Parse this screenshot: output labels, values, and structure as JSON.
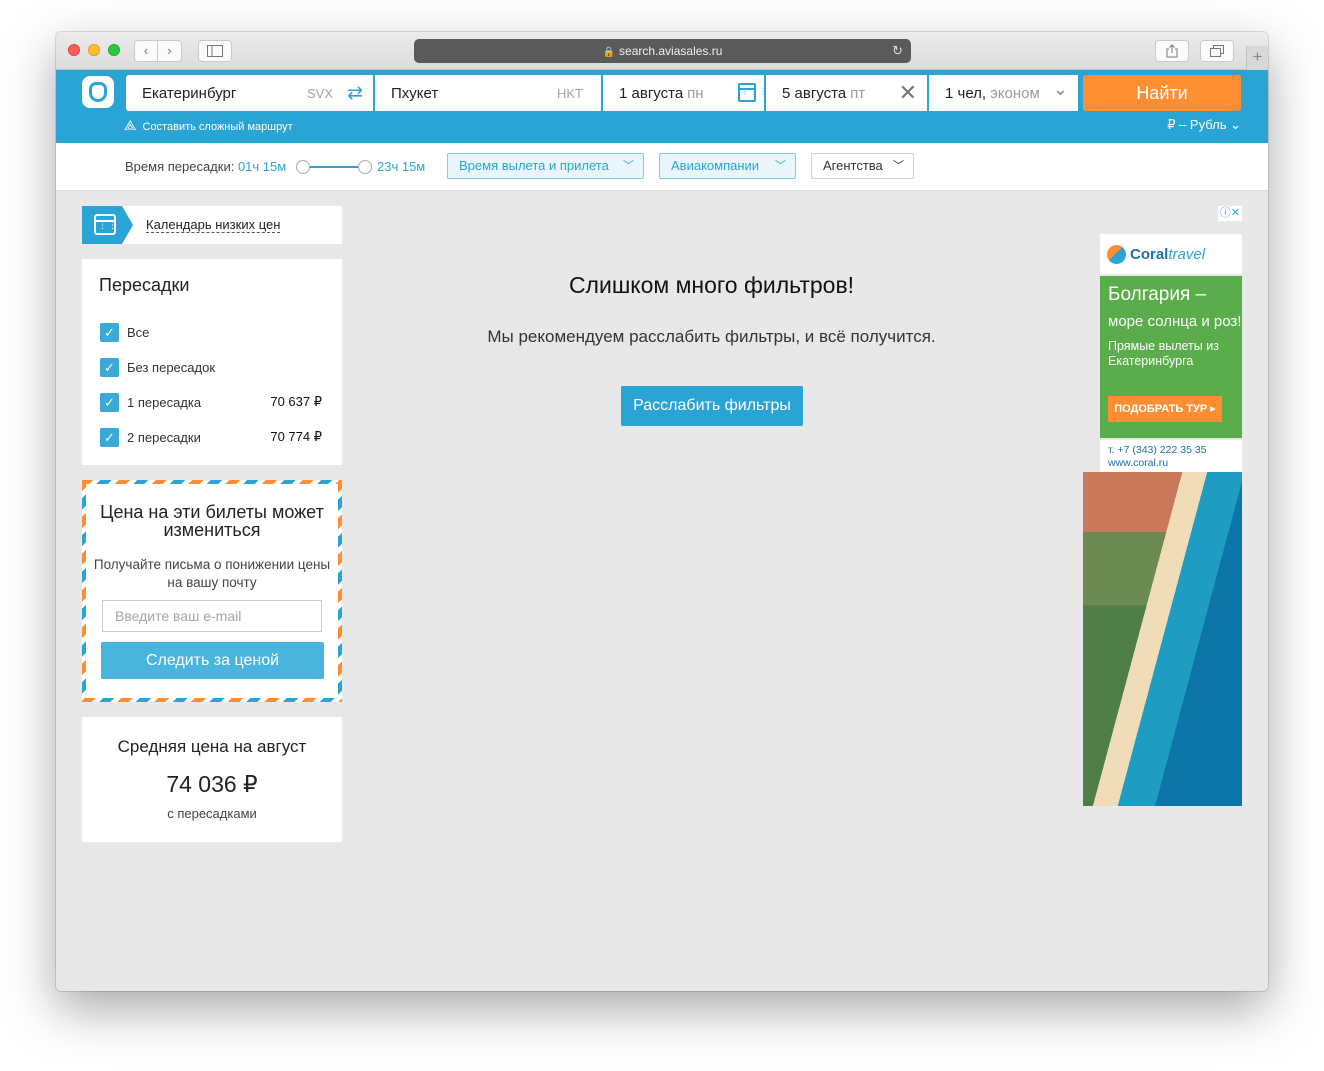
{
  "browser": {
    "url": "search.aviasales.ru",
    "back_glyph": "‹",
    "forward_glyph": "›",
    "reload_glyph": "↻",
    "new_tab_glyph": "+"
  },
  "search": {
    "origin": "Екатеринбург",
    "origin_code": "SVX",
    "destination": "Пхукет",
    "destination_code": "HKT",
    "depart_date": "1 августа",
    "depart_weekday": "пн",
    "return_date": "5 августа",
    "return_weekday": "пт",
    "passengers": "1 чел,",
    "cabin_class": "эконом",
    "find_label": "Найти",
    "complex_route_label": "Составить сложный маршрут",
    "currency_label": "₽ – Рубль"
  },
  "filters": {
    "transfer_time_label": "Время пересадки:",
    "transfer_time_min": "01ч 15м",
    "transfer_time_max": "23ч 15м",
    "departure_arrival_label": "Время вылета и прилета",
    "airlines_label": "Авиакомпании",
    "agencies_label": "Агентства"
  },
  "calendar": {
    "label": "Календарь низких цен"
  },
  "stops": {
    "title": "Пересадки",
    "items": [
      {
        "label": "Все",
        "price": "",
        "checked": true
      },
      {
        "label": "Без пересадок",
        "price": "",
        "checked": true
      },
      {
        "label": "1 пересадка",
        "price": "70 637 ₽",
        "checked": true
      },
      {
        "label": "2 пересадки",
        "price": "70 774 ₽",
        "checked": true
      }
    ]
  },
  "subscribe": {
    "title": "Цена на эти билеты может измениться",
    "description": "Получайте письма о понижении цены на вашу почту",
    "email_placeholder": "Введите ваш e-mail",
    "button_label": "Следить за ценой"
  },
  "average": {
    "title": "Средняя цена на август",
    "value": "74 036 ₽",
    "subtitle": "с пересадками"
  },
  "empty_state": {
    "title": "Слишком много фильтров!",
    "text": "Мы рекомендуем расслабить фильтры, и всё получится.",
    "button_label": "Расслабить фильтры"
  },
  "ad": {
    "controls": "ⓘ✕",
    "brand": "Coral",
    "brand_suffix": "travel",
    "headline": "Болгария –",
    "subline": "море солнца и роз!",
    "small": "Прямые вылеты из Екатеринбурга",
    "cta": "ПОДОБРАТЬ ТУР ▸",
    "phone": "т. +7 (343) 222 35 35",
    "site": "www.coral.ru"
  },
  "colors": {
    "brand_blue": "#2aa4d4",
    "find_orange": "#ff8e33",
    "page_bg": "#e8e8e8"
  }
}
